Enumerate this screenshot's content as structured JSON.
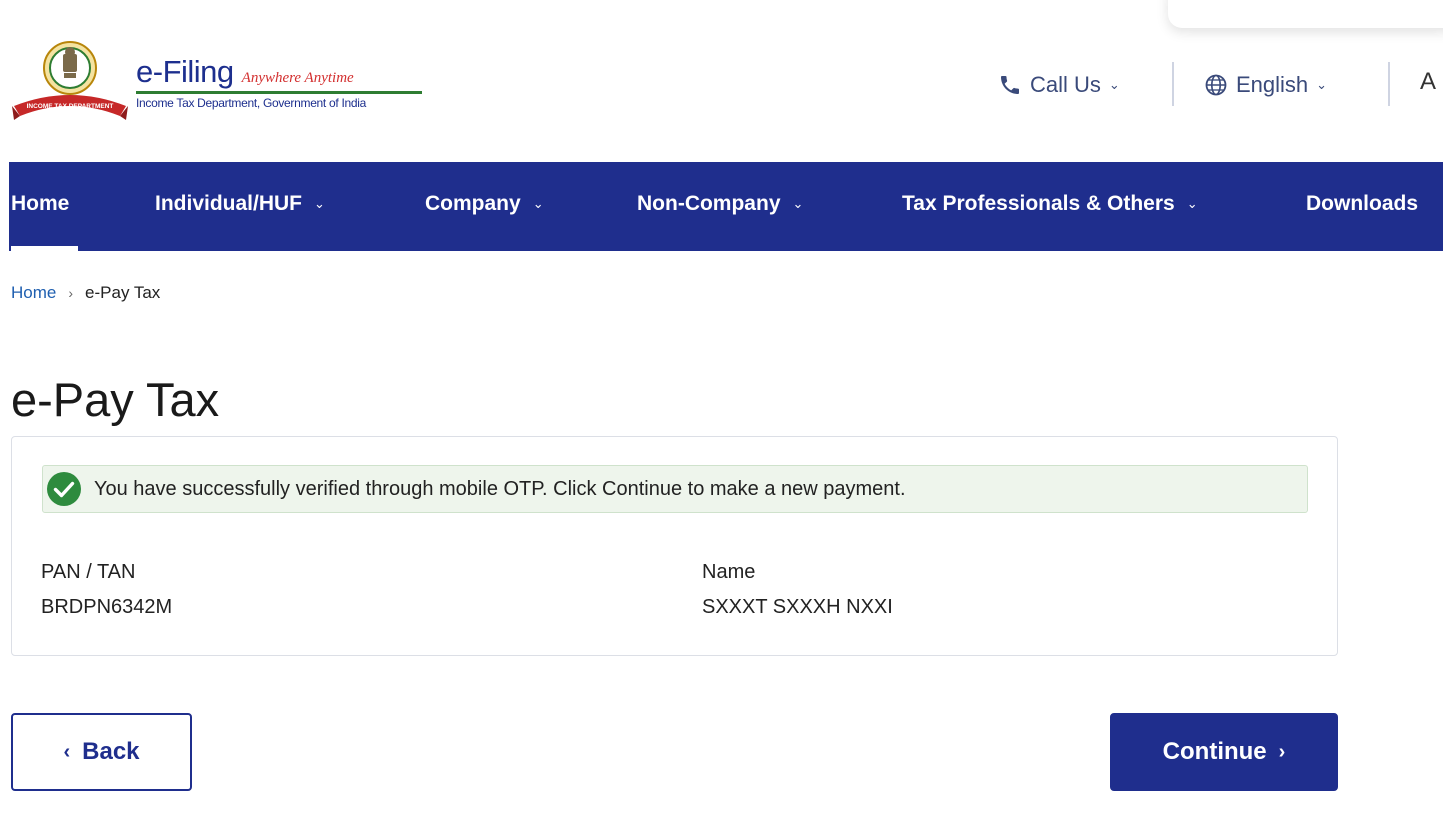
{
  "header": {
    "brand_title": "e-Filing",
    "brand_tagline": "Anywhere Anytime",
    "brand_subtitle": "Income Tax Department, Government of India",
    "emblem_ribbon_text": "INCOME TAX DEPARTMENT",
    "call_us": "Call Us",
    "language": "English",
    "font_size_glyph": "A"
  },
  "nav": {
    "items": [
      {
        "label": "Home",
        "has_dropdown": false,
        "active": true
      },
      {
        "label": "Individual/HUF",
        "has_dropdown": true
      },
      {
        "label": "Company",
        "has_dropdown": true
      },
      {
        "label": "Non-Company",
        "has_dropdown": true
      },
      {
        "label": "Tax Professionals & Others",
        "has_dropdown": true
      },
      {
        "label": "Downloads",
        "has_dropdown": false
      }
    ]
  },
  "breadcrumb": {
    "home": "Home",
    "separator": "›",
    "current": "e-Pay Tax"
  },
  "page": {
    "title": "e-Pay Tax"
  },
  "card": {
    "alert": "You have successfully verified through mobile OTP. Click Continue to make a new payment.",
    "pan_label": "PAN / TAN",
    "pan_value": "BRDPN6342M",
    "name_label": "Name",
    "name_value": "SXXXT SXXXH NXXI"
  },
  "buttons": {
    "back": "Back",
    "back_icon": "‹",
    "continue": "Continue",
    "continue_icon": "›"
  },
  "icons": {
    "phone": "phone-icon",
    "globe": "globe-icon",
    "chevron": "chevron-down-icon",
    "success": "check-circle-icon"
  },
  "colors": {
    "brand_blue": "#1f2e8d",
    "link_blue": "#1f5fb0",
    "success_green": "#2e8b3e",
    "alert_bg": "#eef5ec",
    "tagline_red": "#d32f2f"
  }
}
